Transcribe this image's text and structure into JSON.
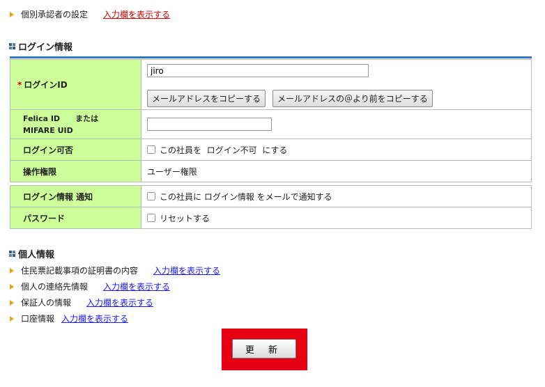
{
  "top_item": {
    "label": "個別承認者の設定",
    "link": "入力欄を表示する"
  },
  "login_section": {
    "title": "ログイン情報",
    "rows": {
      "login_id": {
        "required_mark": "*",
        "label": "ログインID",
        "value": "jiro",
        "copy_email_button": "メールアドレスをコピーする",
        "copy_before_at_button": "メールアドレスの＠より前をコピーする"
      },
      "felica": {
        "label_line1": "Felica ID　　または",
        "label_line2": "MIFARE UID",
        "value": ""
      },
      "login_allowed": {
        "label": "ログイン可否",
        "checkbox_label": "この社員を  ログイン不可  にする"
      },
      "permission": {
        "label": "操作権限",
        "value": "ユーザー権限"
      },
      "notify": {
        "label": "ログイン情報 通知",
        "checkbox_label": "この社員に ログイン情報 をメールで通知する"
      },
      "password": {
        "label": "パスワード",
        "checkbox_label": "リセットする"
      }
    }
  },
  "personal_section": {
    "title": "個人情報",
    "items": [
      {
        "label": "住民票記載事項の証明書の内容",
        "link": "入力欄を表示する"
      },
      {
        "label": "個人の連絡先情報",
        "link": "入力欄を表示する"
      },
      {
        "label": "保証人の情報",
        "link": "入力欄を表示する"
      },
      {
        "label": "口座情報",
        "link": "入力欄を表示する"
      }
    ]
  },
  "update_button": "更 新",
  "colors": {
    "header_bg": "#ccff99",
    "accent_bar": "#2f79c7",
    "highlight": "#e60012",
    "bullet": "#e8a317"
  }
}
